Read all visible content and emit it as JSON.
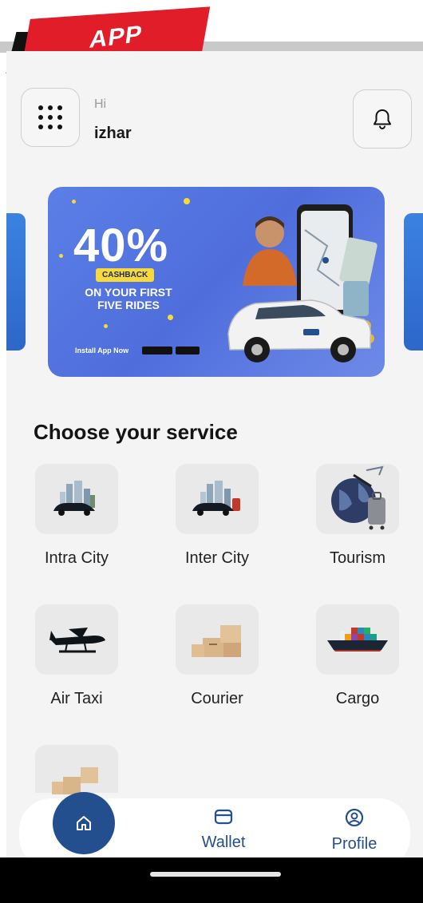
{
  "badge": {
    "label": "APP"
  },
  "header": {
    "greeting": "Hi",
    "username": "izhar"
  },
  "banner": {
    "discount": "40%",
    "cashback": "CASHBACK",
    "line1": "ON YOUR FIRST",
    "line2": "FIVE RIDES",
    "install": "Install App Now"
  },
  "services": {
    "title": "Choose your service",
    "items": [
      {
        "label": "Intra City",
        "icon": "city-car-icon"
      },
      {
        "label": "Inter City",
        "icon": "city-car-icon"
      },
      {
        "label": "Tourism",
        "icon": "globe-luggage-icon"
      },
      {
        "label": "Air Taxi",
        "icon": "seaplane-icon"
      },
      {
        "label": "Courier",
        "icon": "boxes-icon"
      },
      {
        "label": "Cargo",
        "icon": "cargo-ship-icon"
      }
    ]
  },
  "nav": {
    "wallet": "Wallet",
    "profile": "Profile"
  },
  "colors": {
    "primary": "#234f8f",
    "badge_red": "#e21d2a",
    "background": "#f4f4f4"
  }
}
